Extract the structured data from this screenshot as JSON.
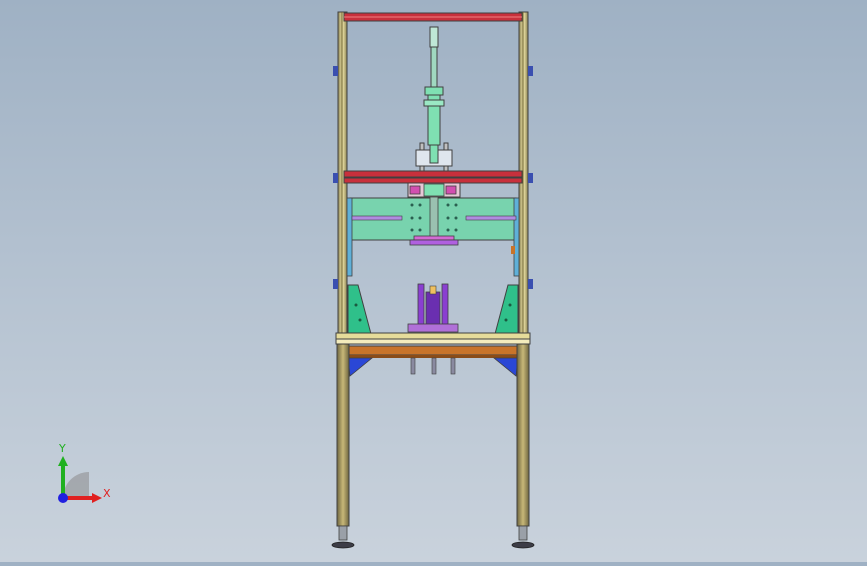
{
  "viewport": {
    "background_top": "#9fb1c4",
    "background_bottom": "#c9d2dc"
  },
  "colors": {
    "frame_outline": "#404040",
    "frame_fill": "#e6dc9a",
    "rail_red": "#c8303c",
    "plate_green": "#78d3ae",
    "cylinder_green": "#7fe0b2",
    "purple": "#8a3fd1",
    "blue_bracket": "#2a47d6",
    "orange": "#c8742a",
    "leg_brown": "#9a8a60"
  },
  "triad": {
    "x_label": "X",
    "y_label": "Y",
    "x_color": "#e02020",
    "y_color": "#20b020",
    "z_color": "#2020e0"
  }
}
